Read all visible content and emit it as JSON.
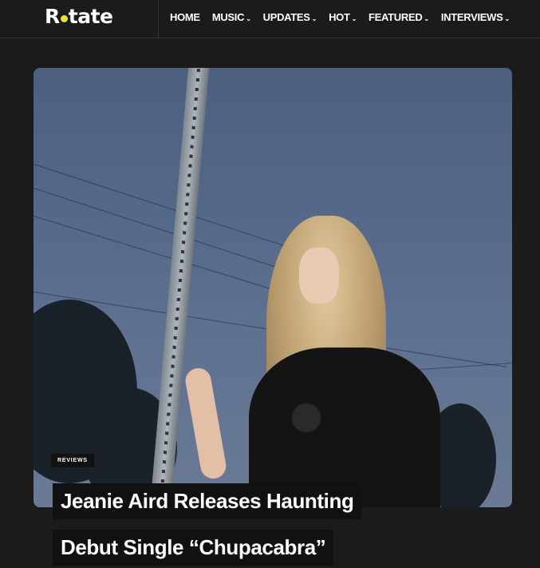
{
  "logo": {
    "part1": "R",
    "part2": "tate"
  },
  "nav": [
    {
      "label": "HOME",
      "dropdown": false
    },
    {
      "label": "MUSIC",
      "dropdown": true
    },
    {
      "label": "UPDATES",
      "dropdown": true
    },
    {
      "label": "HOT",
      "dropdown": true
    },
    {
      "label": "FEATURED",
      "dropdown": true
    },
    {
      "label": "INTERVIEWS",
      "dropdown": true
    }
  ],
  "article": {
    "category": "REVIEWS",
    "title_line1": "Jeanie Aird Releases Haunting",
    "title_line2": "Debut Single “Chupacabra”"
  },
  "colors": {
    "background": "#1b1b1b",
    "accent": "#e8e230",
    "badge_bg": "#111111"
  }
}
